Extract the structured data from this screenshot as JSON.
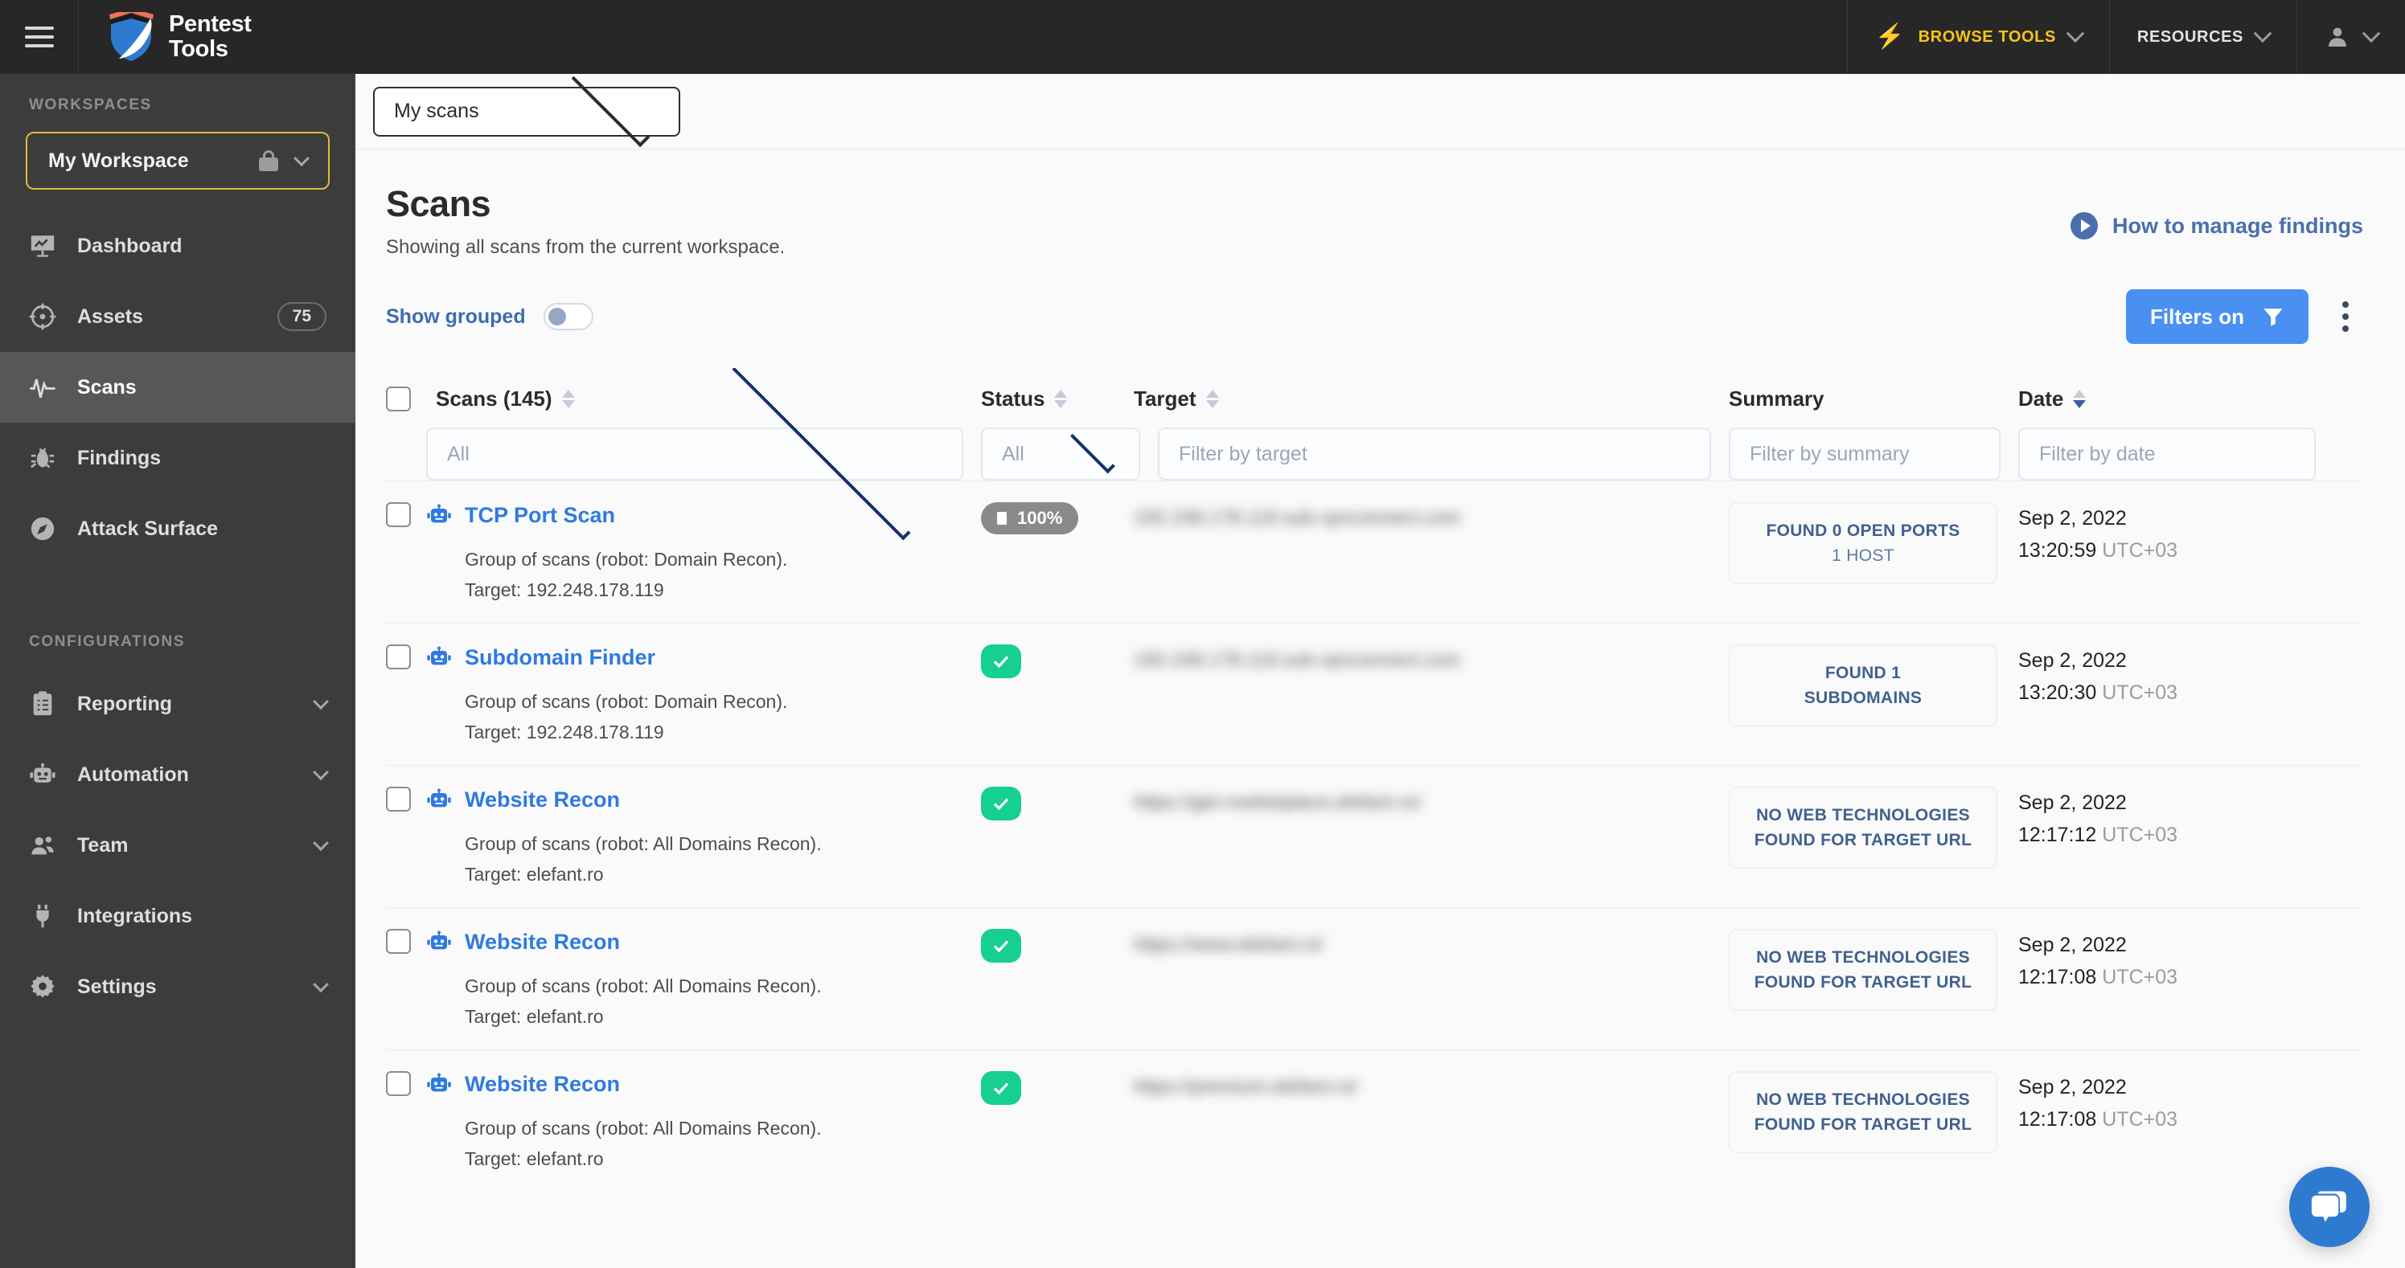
{
  "topbar": {
    "menu_icon": "hamburger-icon",
    "brand_line1": "Pentest",
    "brand_line2": "Tools",
    "browse_tools": "BROWSE TOOLS",
    "resources": "RESOURCES",
    "bolt_icon": "lightning-bolt-icon",
    "user_icon": "user-avatar-icon"
  },
  "sidebar": {
    "workspaces_label": "WORKSPACES",
    "workspace_name": "My Workspace",
    "configurations_label": "CONFIGURATIONS",
    "primary_items": [
      {
        "label": "Dashboard",
        "icon": "dashboard-icon",
        "badge": "",
        "active": false
      },
      {
        "label": "Assets",
        "icon": "target-icon",
        "badge": "75",
        "active": false
      },
      {
        "label": "Scans",
        "icon": "activity-icon",
        "badge": "",
        "active": true
      },
      {
        "label": "Findings",
        "icon": "bug-icon",
        "badge": "",
        "active": false
      },
      {
        "label": "Attack Surface",
        "icon": "compass-icon",
        "badge": "",
        "active": false
      }
    ],
    "config_items": [
      {
        "label": "Reporting",
        "icon": "clipboard-icon",
        "expandable": true
      },
      {
        "label": "Automation",
        "icon": "robot-icon",
        "expandable": true
      },
      {
        "label": "Team",
        "icon": "people-icon",
        "expandable": true
      },
      {
        "label": "Integrations",
        "icon": "plug-icon",
        "expandable": false
      },
      {
        "label": "Settings",
        "icon": "gear-icon",
        "expandable": true
      }
    ]
  },
  "scan_selector": {
    "value": "My scans"
  },
  "header": {
    "title": "Scans",
    "subtitle": "Showing all scans from the current workspace.",
    "howto_link": "How to manage findings"
  },
  "toolbar": {
    "show_grouped_label": "Show grouped",
    "show_grouped_on": false,
    "filters_label": "Filters on",
    "filters_active": true,
    "accent_blue": "#4a90f2"
  },
  "table": {
    "columns": [
      {
        "label": "Scans (145)",
        "sortable": true,
        "sort": "none"
      },
      {
        "label": "Status",
        "sortable": true,
        "sort": "none"
      },
      {
        "label": "Target",
        "sortable": true,
        "sort": "none"
      },
      {
        "label": "Summary",
        "sortable": false,
        "sort": "none"
      },
      {
        "label": "Date",
        "sortable": true,
        "sort": "desc"
      }
    ],
    "filters": {
      "scans": "All",
      "status": "All",
      "target_placeholder": "Filter by target",
      "summary_placeholder": "Filter by summary",
      "date_placeholder": "Filter by date"
    },
    "rows": [
      {
        "name": "TCP Port Scan",
        "group": "Group of scans (robot: Domain Recon).",
        "target_line": "Target: 192.248.178.119",
        "status_type": "progress",
        "status_value": "100%",
        "target_masked": "192.248.178.119.sub-vpnconnect.com",
        "summary_main": "FOUND 0 OPEN PORTS",
        "summary_sub": "1 HOST",
        "date": "Sep 2, 2022",
        "time": "13:20:59",
        "tz": "UTC+03"
      },
      {
        "name": "Subdomain Finder",
        "group": "Group of scans (robot: Domain Recon).",
        "target_line": "Target: 192.248.178.119",
        "status_type": "done",
        "status_value": "",
        "target_masked": "192.248.178.119.sub-vpnconnect.com",
        "summary_main": "FOUND 1",
        "summary_sub": "SUBDOMAINS",
        "date": "Sep 2, 2022",
        "time": "13:20:30",
        "tz": "UTC+03"
      },
      {
        "name": "Website Recon",
        "group": "Group of scans (robot: All Domains Recon).",
        "target_line": "Target: elefant.ro",
        "status_type": "done",
        "status_value": "",
        "target_masked": "https://get-marketplace.elefant.ro/",
        "summary_main": "NO WEB TECHNOLOGIES FOUND FOR TARGET URL",
        "summary_sub": "",
        "date": "Sep 2, 2022",
        "time": "12:17:12",
        "tz": "UTC+03"
      },
      {
        "name": "Website Recon",
        "group": "Group of scans (robot: All Domains Recon).",
        "target_line": "Target: elefant.ro",
        "status_type": "done",
        "status_value": "",
        "target_masked": "https://www.elefant.ro/",
        "summary_main": "NO WEB TECHNOLOGIES FOUND FOR TARGET URL",
        "summary_sub": "",
        "date": "Sep 2, 2022",
        "time": "12:17:08",
        "tz": "UTC+03"
      },
      {
        "name": "Website Recon",
        "group": "Group of scans (robot: All Domains Recon).",
        "target_line": "Target: elefant.ro",
        "status_type": "done",
        "status_value": "",
        "target_masked": "https://premium.elefant.ro/",
        "summary_main": "NO WEB TECHNOLOGIES FOUND FOR TARGET URL",
        "summary_sub": "",
        "date": "Sep 2, 2022",
        "time": "12:17:08",
        "tz": "UTC+03"
      }
    ]
  },
  "chat": {
    "icon": "chat-bubbles-icon"
  }
}
